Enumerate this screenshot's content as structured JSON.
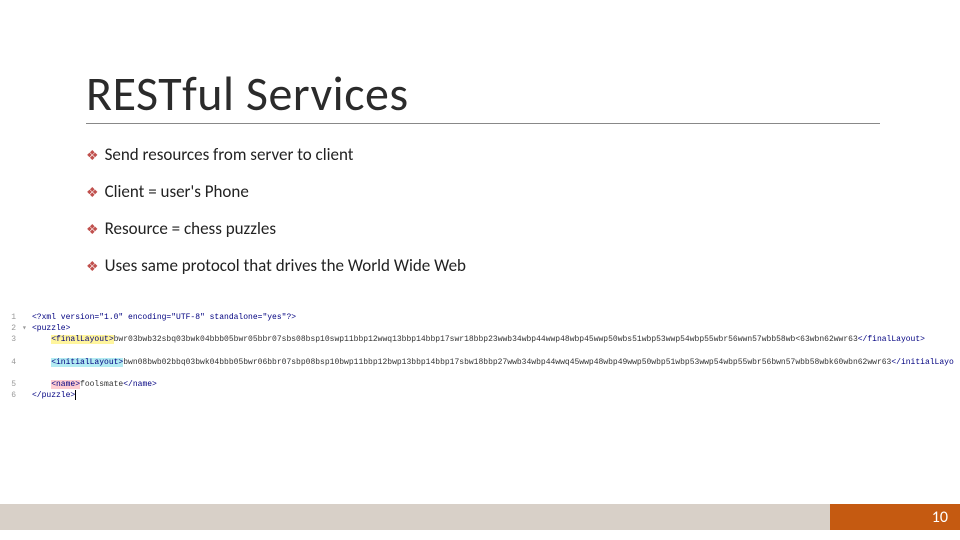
{
  "title": "RESTful Services",
  "bullets": [
    "Send resources from server to client",
    "Client = user's Phone",
    "Resource = chess puzzles",
    "Uses same protocol that drives the World Wide Web"
  ],
  "code": {
    "lines": [
      {
        "num": "1",
        "folder": "",
        "prefix": "",
        "segments": [
          {
            "text": "<?xml version=\"1.0\" encoding=\"UTF-8\" standalone=\"yes\"?>",
            "cls": "xml-tag"
          }
        ]
      },
      {
        "num": "2",
        "folder": "▾",
        "prefix": "",
        "segments": [
          {
            "text": "<puzzle>",
            "cls": "xml-tag"
          }
        ]
      },
      {
        "num": "3",
        "folder": "",
        "prefix": "    ",
        "segments": [
          {
            "text": "<finalLayout>",
            "cls": "xml-tag hl-yellow"
          },
          {
            "text": "bwr03bwb32sbq03bwk04bbb05bwr05bbr07sbs08bsp10swp11bbp12wwq13bbp14bbp17swr18bbp23wwb34wbp44wwp48wbp45wwp50wbs51wbp53wwp54wbp55wbr56wwn57wbb58wb<63wbn62wwr63",
            "cls": "xml-text"
          },
          {
            "text": "</finalLayout>",
            "cls": "xml-tag"
          }
        ]
      },
      {
        "num": "",
        "folder": "",
        "prefix": "        ",
        "segments": []
      },
      {
        "num": "4",
        "folder": "",
        "prefix": "    ",
        "segments": [
          {
            "text": "<initialLayout>",
            "cls": "xml-tag hl-cyan"
          },
          {
            "text": "bwn08bwb02bbq03bwk04bbb05bwr06bbr07sbp08bsp10bwp11bbp12bwp13bbp14bbp17sbw18bbp27wwb34wbp44wwq45wwp48wbp49wwp50wbp51wbp53wwp54wbp55wbr56bwn57wbb58wbk60wbn62wwr63",
            "cls": "xml-text"
          },
          {
            "text": "</initialLayout>",
            "cls": "xml-tag"
          }
        ]
      },
      {
        "num": "",
        "folder": "",
        "prefix": "        ",
        "segments": []
      },
      {
        "num": "5",
        "folder": "",
        "prefix": "    ",
        "segments": [
          {
            "text": "<name>",
            "cls": "xml-tag hl-red"
          },
          {
            "text": "foolsmate",
            "cls": "xml-text"
          },
          {
            "text": "</name>",
            "cls": "xml-tag"
          }
        ]
      },
      {
        "num": "6",
        "folder": "",
        "prefix": "",
        "segments": [
          {
            "text": "</puzzle>",
            "cls": "xml-tag"
          }
        ],
        "cursor": true
      }
    ]
  },
  "page_number": "10"
}
